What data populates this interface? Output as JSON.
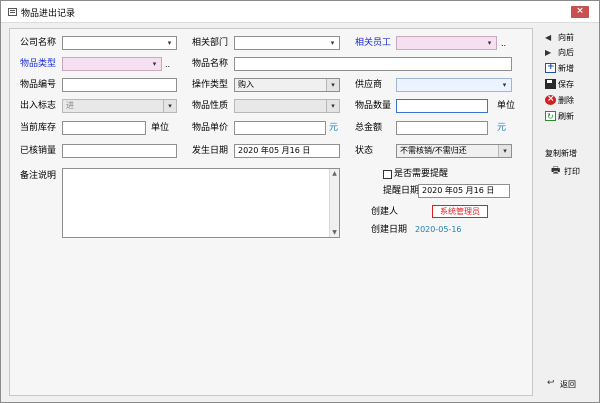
{
  "window": {
    "title": "物品进出记录",
    "close_label": "×"
  },
  "labels": {
    "company": "公司名称",
    "dept": "相关部门",
    "staff": "相关员工",
    "item_type": "物品类型",
    "item_name": "物品名称",
    "item_code": "物品编号",
    "op_type": "操作类型",
    "supplier": "供应商",
    "io_flag": "出入标志",
    "item_nature": "物品性质",
    "item_qty": "物品数量",
    "stock": "当前库存",
    "unit_price": "物品单价",
    "total": "总金额",
    "writeoff": "已核销量",
    "occur_date": "发生日期",
    "status": "状态",
    "remark": "备注说明",
    "need_remind": "是否需要提醒",
    "remind_date": "提醒日期",
    "creator": "创建人",
    "create_date": "创建日期"
  },
  "units": {
    "unit1": "单位",
    "unit2": "单位",
    "yuan1": "元",
    "yuan2": "元"
  },
  "values": {
    "company": "",
    "dept": "",
    "staff": "",
    "item_type": "",
    "item_name": "",
    "item_code": "",
    "op_type": "购入",
    "supplier": "",
    "io_flag": "进",
    "item_nature": "",
    "item_qty": "",
    "stock": "",
    "unit_price": "",
    "total": "",
    "writeoff": "",
    "occur_date": "2020 年05 月16 日",
    "status": "不需核销/不需归还",
    "remind_date": "2020 年05 月16 日",
    "creator": "系统管理员",
    "create_date": "2020-05-16"
  },
  "ellipsis": "..",
  "toolbar": {
    "prev": "向前",
    "next": "向后",
    "new": "新增",
    "save": "保存",
    "delete": "删除",
    "refresh": "刷新",
    "copy_new": "复制新增",
    "print": "打印",
    "back": "返回"
  },
  "icons": {
    "prev": "arrow-left-icon",
    "next": "arrow-right-icon",
    "new": "new-record-icon",
    "save": "save-icon",
    "delete": "delete-icon",
    "refresh": "refresh-icon",
    "print": "printer-icon",
    "back": "return-icon"
  },
  "colors": {
    "required_label": "#1a2bd6",
    "required_field": "#f6dff0",
    "creator_border": "#e02020",
    "date_link": "#1f7fb5"
  }
}
